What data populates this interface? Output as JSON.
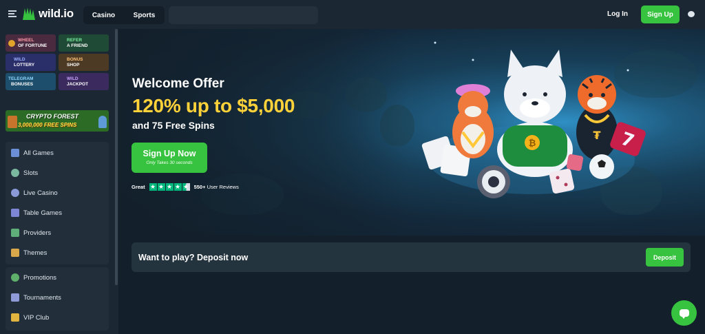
{
  "header": {
    "logo_text": "wild.io",
    "tabs": [
      {
        "label": "Casino"
      },
      {
        "label": "Sports"
      }
    ],
    "login_label": "Log In",
    "signup_label": "Sign Up"
  },
  "sidebar": {
    "promo_tiles": [
      {
        "line1": "WHEEL",
        "line2": "OF FORTUNE",
        "icon": "wheel-icon"
      },
      {
        "line1": "REFER",
        "line2": "A FRIEND",
        "icon": "gift-icon"
      },
      {
        "line1": "WILD",
        "line2": "LOTTERY",
        "icon": "ticket-icon"
      },
      {
        "line1": "BONUS",
        "line2": "SHOP",
        "icon": "shop-icon"
      },
      {
        "line1": "TELEGRAM",
        "line2": "BONUSES",
        "icon": "telegram-icon"
      },
      {
        "line1": "WILD",
        "line2": "JACKPOT",
        "icon": "jackpot-icon"
      }
    ],
    "crypto_banner": {
      "title": "CRYPTO FOREST",
      "subtitle": "3,000,000 FREE SPINS"
    },
    "menu_main": [
      {
        "label": "All Games",
        "icon": "grid-icon"
      },
      {
        "label": "Slots",
        "icon": "slots-icon"
      },
      {
        "label": "Live Casino",
        "icon": "live-dealer-icon"
      },
      {
        "label": "Table Games",
        "icon": "cards-icon"
      },
      {
        "label": "Providers",
        "icon": "providers-icon"
      },
      {
        "label": "Themes",
        "icon": "themes-icon"
      }
    ],
    "menu_secondary": [
      {
        "label": "Promotions",
        "icon": "money-bag-icon"
      },
      {
        "label": "Tournaments",
        "icon": "trophy-icon"
      },
      {
        "label": "VIP Club",
        "icon": "crown-icon"
      }
    ]
  },
  "hero": {
    "title": "Welcome Offer",
    "amount": "120% up to $5,000",
    "spins": "and 75 Free Spins",
    "cta_label": "Sign Up Now",
    "cta_sub": "Only Takes 30 seconds",
    "rating_label": "Great",
    "stars": 4.5,
    "reviews_count": "550+",
    "reviews_suffix": "User Reviews"
  },
  "deposit": {
    "text": "Want to play? Deposit now",
    "button_label": "Deposit"
  },
  "colors": {
    "accent_green": "#37c23f",
    "offer_yellow": "#ffd23a",
    "panel": "#1b2733",
    "background": "#13202b"
  }
}
